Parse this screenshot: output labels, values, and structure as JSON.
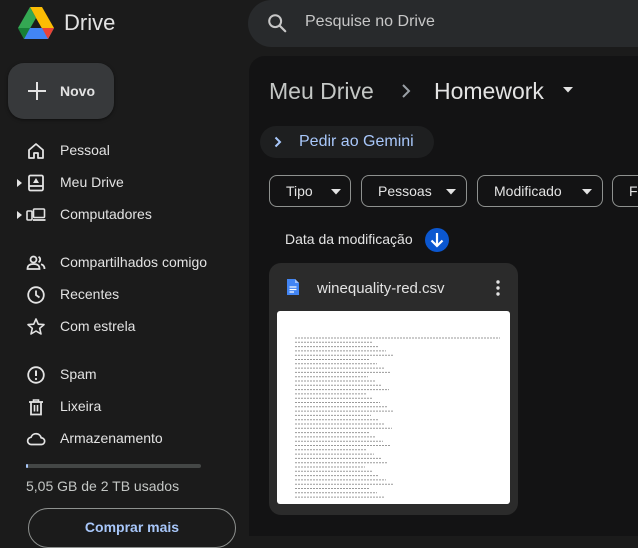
{
  "app": {
    "name": "Drive"
  },
  "search": {
    "placeholder": "Pesquise no Drive"
  },
  "new_button": {
    "label": "Novo"
  },
  "sidebar": {
    "items": [
      {
        "label": "Pessoal",
        "icon": "home-icon"
      },
      {
        "label": "Meu Drive",
        "icon": "my-drive-icon",
        "expandable": true
      },
      {
        "label": "Computadores",
        "icon": "computers-icon",
        "expandable": true
      },
      {
        "label": "Compartilhados comigo",
        "icon": "shared-icon"
      },
      {
        "label": "Recentes",
        "icon": "clock-icon"
      },
      {
        "label": "Com estrela",
        "icon": "star-icon"
      },
      {
        "label": "Spam",
        "icon": "spam-icon"
      },
      {
        "label": "Lixeira",
        "icon": "trash-icon"
      },
      {
        "label": "Armazenamento",
        "icon": "cloud-icon"
      }
    ]
  },
  "storage": {
    "used_text": "5,05 GB de 2 TB usados",
    "used_fraction": 0.0025,
    "buy_label": "Comprar mais"
  },
  "breadcrumb": {
    "root": "Meu Drive",
    "current": "Homework"
  },
  "gemini": {
    "label": "Pedir ao Gemini"
  },
  "filters": [
    {
      "label": "Tipo"
    },
    {
      "label": "Pessoas"
    },
    {
      "label": "Modificado"
    },
    {
      "label": "Fo"
    }
  ],
  "sort": {
    "label": "Data da modificação",
    "direction": "descending"
  },
  "files": [
    {
      "name": "winequality-red.csv",
      "type": "csv"
    }
  ],
  "colors": {
    "background": "#1b1b1b",
    "panel": "#131314",
    "accent": "#a8c7fa",
    "sort_button": "#0b57d0",
    "file_icon": "#4285f4"
  }
}
